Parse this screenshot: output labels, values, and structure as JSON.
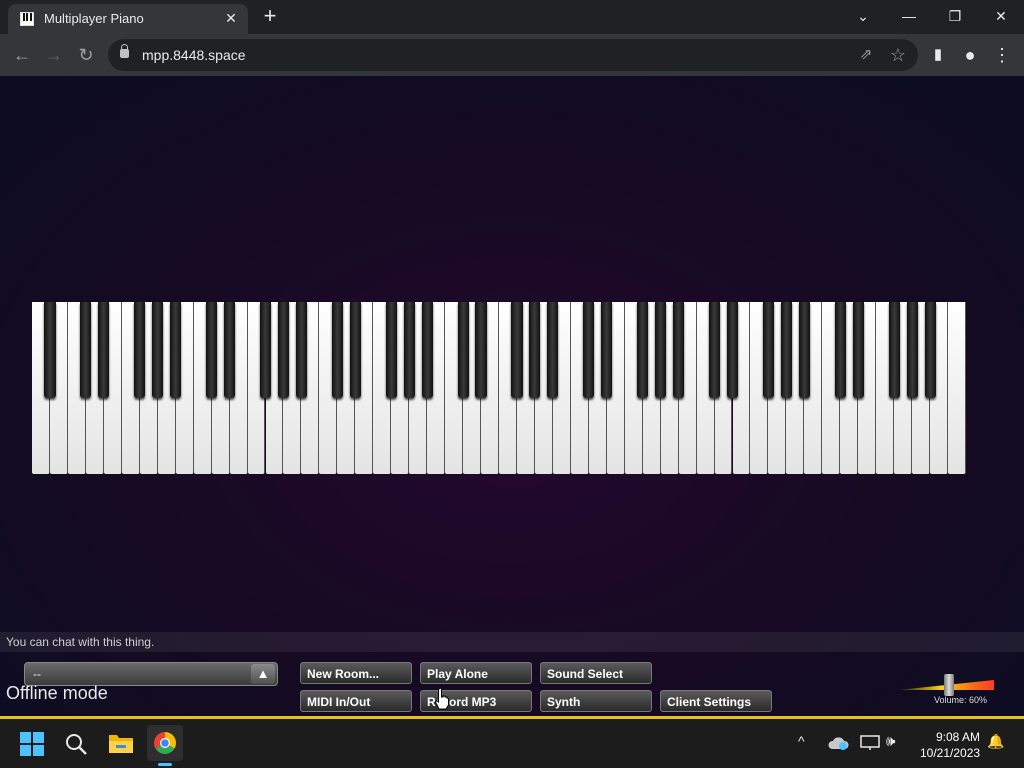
{
  "browser": {
    "tab_title": "Multiplayer Piano",
    "tab_close": "✕",
    "new_tab": "+",
    "url": "mpp.8448.space",
    "window_controls": {
      "dropdown": "⌄",
      "minimize": "—",
      "restore": "❐",
      "close": "✕"
    }
  },
  "toolbar_icons": {
    "back": "←",
    "forward": "→",
    "reload": "↻",
    "share": "⇗",
    "bookmark": "☆",
    "sidepanel": "▮",
    "profile": "●",
    "menu": "⋮"
  },
  "piano": {
    "white_keys": 52,
    "black_keys": 36
  },
  "chat": {
    "hint": "You can chat with this thing."
  },
  "room": {
    "value": "--",
    "arrow": "▲"
  },
  "status": {
    "mode": "Offline mode"
  },
  "buttons": {
    "new_room": "New Room...",
    "play_alone": "Play Alone",
    "sound_select": "Sound Select",
    "midi": "MIDI In/Out",
    "record_mp3": "Record MP3",
    "synth": "Synth",
    "client_settings": "Client Settings"
  },
  "volume": {
    "label": "Volume: 60%",
    "level": 0.6
  },
  "taskbar": {
    "time": "9:08 AM",
    "date": "10/21/2023",
    "tray": {
      "chevron": "^",
      "speaker": "🕪",
      "bell": "🔔"
    }
  },
  "colors": {
    "browser_dark": "#202124",
    "browser_toolbar": "#35363a",
    "page_bg": "#150a22",
    "accent_border": "#e8c21a",
    "taskbar_active": "#4cc2ff"
  }
}
